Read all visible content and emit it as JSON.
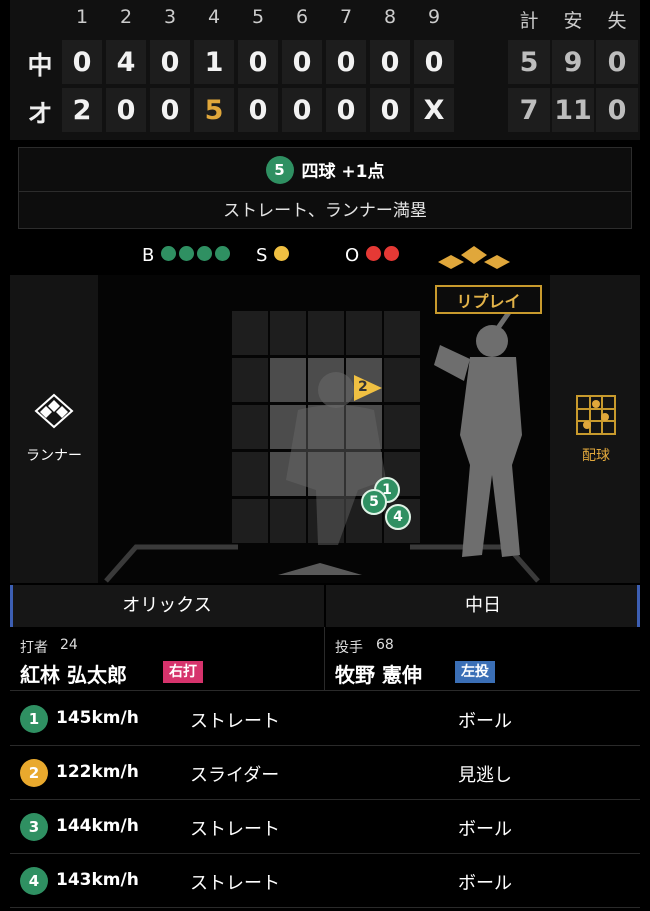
{
  "scoreboard": {
    "innings": [
      "1",
      "2",
      "3",
      "4",
      "5",
      "6",
      "7",
      "8",
      "9"
    ],
    "total_headers": [
      "計",
      "安",
      "失"
    ],
    "teams": [
      {
        "abbr": "中",
        "scores": [
          "0",
          "4",
          "0",
          "1",
          "0",
          "0",
          "0",
          "0",
          "0"
        ],
        "totals": [
          "5",
          "9",
          "0"
        ]
      },
      {
        "abbr": "オ",
        "scores": [
          "2",
          "0",
          "0",
          "5",
          "0",
          "0",
          "0",
          "0",
          "X"
        ],
        "totals": [
          "7",
          "11",
          "0"
        ]
      }
    ],
    "highlight_color": "#e0a73b"
  },
  "event": {
    "number": "5",
    "title": "四球 +1点",
    "description": "ストレート、ランナー満塁"
  },
  "count": {
    "ball_label": "B",
    "balls": 4,
    "strike_label": "S",
    "strikes": 1,
    "out_label": "O",
    "outs": 2
  },
  "field": {
    "replay_label": "リプレイ",
    "runner_label": "ランナー",
    "pitch_chart_label": "配球"
  },
  "teams_bar": {
    "left": "オリックス",
    "right": "中日"
  },
  "batter": {
    "role": "打者",
    "number": "24",
    "name": "紅林 弘太郎",
    "hand": "右打",
    "hand_color": "#d6336c"
  },
  "pitcher": {
    "role": "投手",
    "number": "68",
    "name": "牧野 憲伸",
    "hand": "左投",
    "hand_color": "#3b6fb6"
  },
  "pitches": [
    {
      "num": "1",
      "speed": "145km/h",
      "type": "ストレート",
      "result": "ボール",
      "color": "#2f9062"
    },
    {
      "num": "2",
      "speed": "122km/h",
      "type": "スライダー",
      "result": "見逃し",
      "color": "#e9a92d"
    },
    {
      "num": "3",
      "speed": "144km/h",
      "type": "ストレート",
      "result": "ボール",
      "color": "#2f9062"
    },
    {
      "num": "4",
      "speed": "143km/h",
      "type": "ストレート",
      "result": "ボール",
      "color": "#2f9062"
    }
  ],
  "zone_marks": [
    {
      "num": "1",
      "kind": "ball"
    },
    {
      "num": "2",
      "kind": "slider"
    },
    {
      "num": "4",
      "kind": "ball"
    },
    {
      "num": "5",
      "kind": "ball"
    }
  ]
}
